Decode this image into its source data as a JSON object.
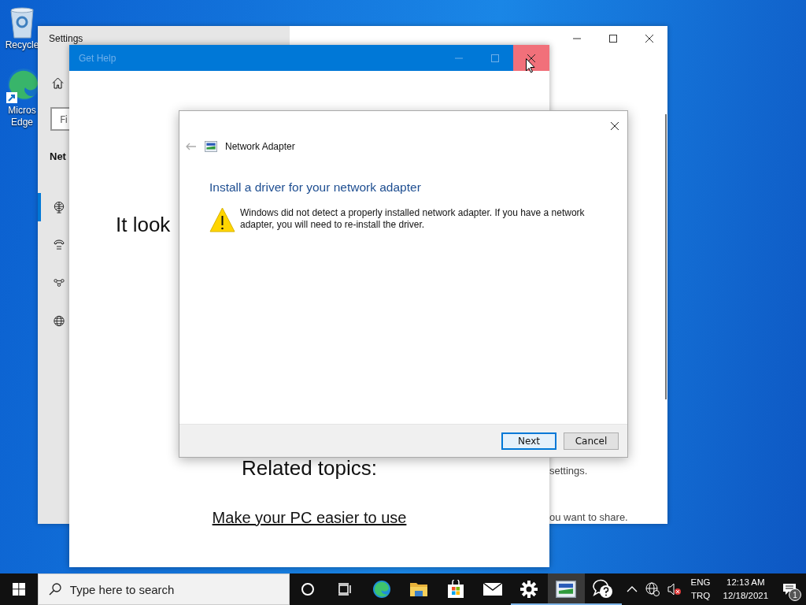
{
  "desktop": {
    "icons": [
      {
        "kind": "recycle-bin",
        "lines": [
          "Recycle"
        ]
      },
      {
        "kind": "edge",
        "lines": [
          "Micros",
          "Edge"
        ]
      }
    ]
  },
  "settings_window": {
    "title": "Settings",
    "search": {
      "placeholder": "Fi"
    },
    "heading": "Net",
    "nav_items": [
      {
        "kind": "ethernet",
        "selected": true
      },
      {
        "kind": "dialup",
        "selected": false
      },
      {
        "kind": "vpn",
        "selected": false
      },
      {
        "kind": "proxy",
        "selected": false
      }
    ],
    "texts": [
      "settings.",
      "ou want to share."
    ]
  },
  "help_window": {
    "title": "Get Help",
    "close_hovered": true,
    "headline": "It look",
    "related_heading": "Related topics:",
    "links": [
      "Make your PC easier to use"
    ]
  },
  "dialog": {
    "title": "Network Adapter",
    "heading": "Install a driver for your network adapter",
    "message": "Windows did not detect a properly installed network adapter. If you have a network adapter, you will need to re-install the driver.",
    "buttons": [
      {
        "label": "Next",
        "default": true
      },
      {
        "label": "Cancel",
        "default": false
      }
    ]
  },
  "taskbar": {
    "search": {
      "placeholder": "Type here to search"
    },
    "apps": [
      {
        "kind": "cortana",
        "running": false,
        "active": false
      },
      {
        "kind": "task-view",
        "running": false,
        "active": false
      },
      {
        "kind": "edge",
        "running": false,
        "active": false
      },
      {
        "kind": "folder",
        "running": false,
        "active": false
      },
      {
        "kind": "store",
        "running": false,
        "active": false
      },
      {
        "kind": "mail",
        "running": false,
        "active": false
      },
      {
        "kind": "settings",
        "running": true,
        "active": false
      },
      {
        "kind": "network-adapter",
        "running": true,
        "active": true
      },
      {
        "kind": "feedback",
        "running": true,
        "active": false
      }
    ],
    "tray": {
      "language": "ENG",
      "layout": "TRQ",
      "time": "12:13 AM",
      "date": "12/18/2021",
      "notifications": "1"
    }
  }
}
